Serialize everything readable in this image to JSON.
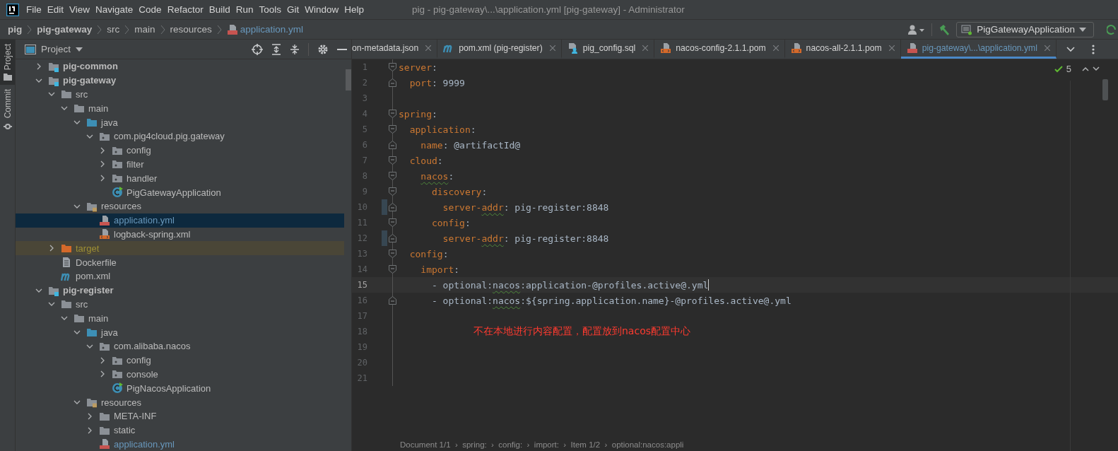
{
  "menu": {
    "items": [
      "File",
      "Edit",
      "View",
      "Navigate",
      "Code",
      "Refactor",
      "Build",
      "Run",
      "Tools",
      "Git",
      "Window",
      "Help"
    ],
    "title": "pig - pig-gateway\\...\\application.yml [pig-gateway] - Administrator"
  },
  "breadcrumb": [
    {
      "label": "pig",
      "kind": "module",
      "modified": false
    },
    {
      "label": "pig-gateway",
      "kind": "module",
      "modified": false
    },
    {
      "label": "src",
      "kind": "folder",
      "modified": false
    },
    {
      "label": "main",
      "kind": "folder",
      "modified": false
    },
    {
      "label": "resources",
      "kind": "folder",
      "modified": false
    },
    {
      "label": "application.yml",
      "kind": "yml-file",
      "modified": true
    }
  ],
  "run_config": "PigGatewayApplication",
  "side_tabs": [
    {
      "label": "Project",
      "selected": true
    },
    {
      "label": "Commit",
      "selected": false
    }
  ],
  "project": {
    "title": "Project",
    "tree": [
      {
        "label": "pig-common",
        "kind": "module",
        "expanded": false,
        "selected": false,
        "modified": false
      },
      {
        "label": "pig-gateway",
        "kind": "module",
        "expanded": true,
        "selected": false,
        "modified": false,
        "children": [
          {
            "label": "src",
            "kind": "folder",
            "expanded": true,
            "selected": false,
            "modified": false,
            "children": [
              {
                "label": "main",
                "kind": "folder",
                "expanded": true,
                "selected": false,
                "modified": false,
                "children": [
                  {
                    "label": "java",
                    "kind": "source-root",
                    "expanded": true,
                    "selected": false,
                    "modified": false,
                    "children": [
                      {
                        "label": "com.pig4cloud.pig.gateway",
                        "kind": "package",
                        "expanded": true,
                        "selected": false,
                        "modified": false,
                        "children": [
                          {
                            "label": "config",
                            "kind": "package",
                            "expanded": false,
                            "selected": false,
                            "modified": false
                          },
                          {
                            "label": "filter",
                            "kind": "package",
                            "expanded": false,
                            "selected": false,
                            "modified": false
                          },
                          {
                            "label": "handler",
                            "kind": "package",
                            "expanded": false,
                            "selected": false,
                            "modified": false
                          },
                          {
                            "label": "PigGatewayApplication",
                            "kind": "class",
                            "selected": false,
                            "modified": false
                          }
                        ]
                      }
                    ]
                  },
                  {
                    "label": "resources",
                    "kind": "resources",
                    "expanded": true,
                    "selected": false,
                    "modified": false,
                    "children": [
                      {
                        "label": "application.yml",
                        "kind": "yml-file",
                        "selected": true,
                        "modified": true
                      },
                      {
                        "label": "logback-spring.xml",
                        "kind": "xml-file",
                        "selected": false,
                        "modified": false
                      }
                    ]
                  }
                ]
              }
            ]
          },
          {
            "label": "target",
            "kind": "excluded-folder",
            "expanded": false,
            "selected": false,
            "modified": false
          },
          {
            "label": "Dockerfile",
            "kind": "text-file",
            "selected": false,
            "modified": false
          },
          {
            "label": "pom.xml",
            "kind": "maven-file",
            "selected": false,
            "modified": false
          }
        ]
      },
      {
        "label": "pig-register",
        "kind": "module",
        "expanded": true,
        "selected": false,
        "modified": false,
        "children": [
          {
            "label": "src",
            "kind": "folder",
            "expanded": true,
            "selected": false,
            "modified": false,
            "children": [
              {
                "label": "main",
                "kind": "folder",
                "expanded": true,
                "selected": false,
                "modified": false,
                "children": [
                  {
                    "label": "java",
                    "kind": "source-root",
                    "expanded": true,
                    "selected": false,
                    "modified": false,
                    "children": [
                      {
                        "label": "com.alibaba.nacos",
                        "kind": "package",
                        "expanded": true,
                        "selected": false,
                        "modified": false,
                        "children": [
                          {
                            "label": "config",
                            "kind": "package",
                            "expanded": false,
                            "selected": false,
                            "modified": false
                          },
                          {
                            "label": "console",
                            "kind": "package",
                            "expanded": false,
                            "selected": false,
                            "modified": false
                          },
                          {
                            "label": "PigNacosApplication",
                            "kind": "class",
                            "selected": false,
                            "modified": false
                          }
                        ]
                      }
                    ]
                  },
                  {
                    "label": "resources",
                    "kind": "resources",
                    "expanded": true,
                    "selected": false,
                    "modified": false,
                    "children": [
                      {
                        "label": "META-INF",
                        "kind": "folder",
                        "expanded": false,
                        "selected": false,
                        "modified": false
                      },
                      {
                        "label": "static",
                        "kind": "folder",
                        "expanded": false,
                        "selected": false,
                        "modified": false
                      },
                      {
                        "label": "application.yml",
                        "kind": "yml-file",
                        "selected": false,
                        "modified": true
                      }
                    ]
                  }
                ]
              }
            ]
          }
        ]
      }
    ]
  },
  "tabs": [
    {
      "label": "on-metadata.json",
      "kind": "json",
      "selected": false,
      "modified": false
    },
    {
      "label": "pom.xml (pig-register)",
      "kind": "maven",
      "selected": false,
      "modified": false
    },
    {
      "label": "pig_config.sql",
      "kind": "sql",
      "selected": false,
      "modified": false
    },
    {
      "label": "nacos-config-2.1.1.pom",
      "kind": "pom",
      "selected": false,
      "modified": false
    },
    {
      "label": "nacos-all-2.1.1.pom",
      "kind": "pom",
      "selected": false,
      "modified": false
    },
    {
      "label": "pig-gateway\\...\\application.yml",
      "kind": "yml",
      "selected": true,
      "modified": true
    }
  ],
  "editor": {
    "problems": "5",
    "lines": [
      {
        "n": "1",
        "fold_start": true,
        "fold_end": false,
        "changed": false,
        "current": false,
        "tokens": [
          {
            "t": "server",
            "kind": "key"
          },
          {
            "t": ":",
            "kind": "text"
          }
        ]
      },
      {
        "n": "2",
        "fold_start": false,
        "fold_end": true,
        "changed": false,
        "current": false,
        "tokens": [
          {
            "t": "  port",
            "kind": "key"
          },
          {
            "t": ": 9999",
            "kind": "text"
          }
        ]
      },
      {
        "n": "3",
        "fold_start": false,
        "fold_end": false,
        "changed": false,
        "current": false
      },
      {
        "n": "4",
        "fold_start": true,
        "fold_end": false,
        "changed": false,
        "current": false,
        "tokens": [
          {
            "t": "spring",
            "kind": "key"
          },
          {
            "t": ":",
            "kind": "text"
          }
        ]
      },
      {
        "n": "5",
        "fold_start": true,
        "fold_end": false,
        "changed": false,
        "current": false,
        "tokens": [
          {
            "t": "  application",
            "kind": "key"
          },
          {
            "t": ":",
            "kind": "text"
          }
        ]
      },
      {
        "n": "6",
        "fold_start": false,
        "fold_end": true,
        "changed": false,
        "current": false,
        "tokens": [
          {
            "t": "    name",
            "kind": "key"
          },
          {
            "t": ": @artifactId@",
            "kind": "text"
          }
        ]
      },
      {
        "n": "7",
        "fold_start": true,
        "fold_end": false,
        "changed": false,
        "current": false,
        "tokens": [
          {
            "t": "  cloud",
            "kind": "key"
          },
          {
            "t": ":",
            "kind": "text"
          }
        ]
      },
      {
        "n": "8",
        "fold_start": true,
        "fold_end": false,
        "changed": false,
        "current": false,
        "tokens": [
          {
            "t": "    nacos",
            "kind": "key",
            "typo": true
          },
          {
            "t": ":",
            "kind": "text"
          }
        ]
      },
      {
        "n": "9",
        "fold_start": true,
        "fold_end": false,
        "changed": false,
        "current": false,
        "tokens": [
          {
            "t": "      discovery",
            "kind": "key"
          },
          {
            "t": ":",
            "kind": "text"
          }
        ]
      },
      {
        "n": "10",
        "fold_start": false,
        "fold_end": true,
        "changed": true,
        "current": false,
        "tokens": [
          {
            "t": "        server-",
            "kind": "key"
          },
          {
            "t": "addr",
            "kind": "key",
            "typo": true
          },
          {
            "t": ": pig-register:8848",
            "kind": "text"
          }
        ]
      },
      {
        "n": "11",
        "fold_start": true,
        "fold_end": false,
        "changed": false,
        "current": false,
        "tokens": [
          {
            "t": "      config",
            "kind": "key"
          },
          {
            "t": ":",
            "kind": "text"
          }
        ]
      },
      {
        "n": "12",
        "fold_start": false,
        "fold_end": true,
        "changed": true,
        "current": false,
        "tokens": [
          {
            "t": "        server-",
            "kind": "key"
          },
          {
            "t": "addr",
            "kind": "key",
            "typo": true
          },
          {
            "t": ": pig-register:8848",
            "kind": "text"
          }
        ]
      },
      {
        "n": "13",
        "fold_start": true,
        "fold_end": false,
        "changed": false,
        "current": false,
        "tokens": [
          {
            "t": "  config",
            "kind": "key"
          },
          {
            "t": ":",
            "kind": "text"
          }
        ]
      },
      {
        "n": "14",
        "fold_start": true,
        "fold_end": false,
        "changed": false,
        "current": false,
        "tokens": [
          {
            "t": "    import",
            "kind": "key"
          },
          {
            "t": ":",
            "kind": "text"
          }
        ]
      },
      {
        "n": "15",
        "fold_start": false,
        "fold_end": false,
        "changed": false,
        "current": true,
        "tokens": [
          {
            "t": "      - optional:",
            "kind": "text"
          },
          {
            "t": "nacos",
            "kind": "text",
            "typo": true
          },
          {
            "t": ":application-@profiles.active@.yml",
            "kind": "text"
          }
        ]
      },
      {
        "n": "16",
        "fold_start": false,
        "fold_end": true,
        "changed": false,
        "current": false,
        "tokens": [
          {
            "t": "      - optional:",
            "kind": "text"
          },
          {
            "t": "nacos",
            "kind": "text",
            "typo": true
          },
          {
            "t": ":${spring.application.name}-@profiles.active@.yml",
            "kind": "text"
          }
        ]
      },
      {
        "n": "17",
        "fold_start": false,
        "fold_end": false,
        "changed": false,
        "current": false
      },
      {
        "n": "18",
        "fold_start": false,
        "fold_end": false,
        "changed": false,
        "current": false,
        "note": "不在本地进行内容配置，配置放到nacos配置中心"
      },
      {
        "n": "19",
        "fold_start": false,
        "fold_end": false,
        "changed": false,
        "current": false
      },
      {
        "n": "20",
        "fold_start": false,
        "fold_end": false,
        "changed": false,
        "current": false
      },
      {
        "n": "21",
        "fold_start": false,
        "fold_end": false,
        "changed": false,
        "current": false
      }
    ]
  },
  "status_path": "Document 1/1  ›  spring:  ›  config:  ›  import:  ›  Item 1/2  ›  optional:nacos:appli"
}
